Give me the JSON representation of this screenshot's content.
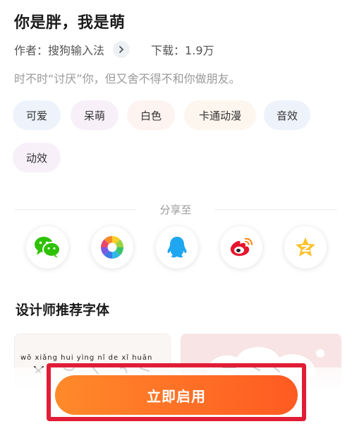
{
  "font": {
    "title": "你是胖，我是萌",
    "author_label": "作者：",
    "author_name": "搜狗输入法",
    "downloads_label": "下载：",
    "downloads_value": "1.9万",
    "description": "时不时“讨厌”你，但又舍不得不和你做朋友。"
  },
  "tags": [
    {
      "label": "可爱",
      "bg": "#eef3fb"
    },
    {
      "label": "呆萌",
      "bg": "#f7f0f9"
    },
    {
      "label": "白色",
      "bg": "#fdf3f1"
    },
    {
      "label": "卡通动漫",
      "bg": "#fdf6ee"
    },
    {
      "label": "音效",
      "bg": "#eef3fb"
    },
    {
      "label": "动效",
      "bg": "#f7f0f9"
    }
  ],
  "share": {
    "label": "分享至",
    "targets": [
      "wechat-icon",
      "moments-icon",
      "qq-icon",
      "weibo-icon",
      "qzone-icon"
    ]
  },
  "recommend": {
    "title": "设计师推荐字体",
    "card_a_pinyin": "wǒ xiǎng hui yìng nǐ de xǐ huān"
  },
  "cta": {
    "label": "立即启用"
  },
  "colors": {
    "accent": "#ff6a24",
    "highlight": "#e11d36"
  }
}
